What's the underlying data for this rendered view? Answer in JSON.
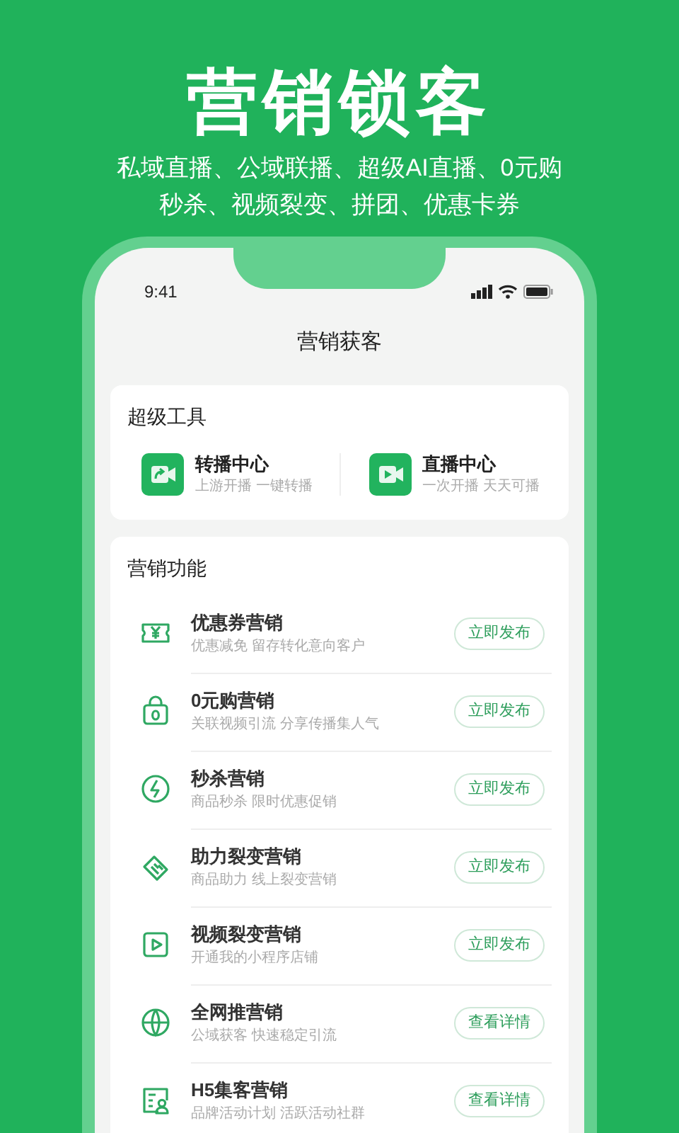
{
  "headline": "营销锁客",
  "subtitle_lines": [
    "私域直播、公域联播、超级AI直播、0元购",
    "秒杀、视频裂变、拼团、优惠卡券"
  ],
  "status_bar": {
    "time": "9:41"
  },
  "screen_title": "营销获客",
  "super_tools": {
    "title": "超级工具",
    "items": [
      {
        "title": "转播中心",
        "subtitle": "上游开播 一键转播"
      },
      {
        "title": "直播中心",
        "subtitle": "一次开播 天天可播"
      }
    ]
  },
  "marketing": {
    "title": "营销功能",
    "items": [
      {
        "title": "优惠券营销",
        "subtitle": "优惠减免 留存转化意向客户",
        "button": "立即发布"
      },
      {
        "title": "0元购营销",
        "subtitle": "关联视频引流 分享传播集人气",
        "button": "立即发布"
      },
      {
        "title": "秒杀营销",
        "subtitle": "商品秒杀 限时优惠促销",
        "button": "立即发布"
      },
      {
        "title": "助力裂变营销",
        "subtitle": "商品助力 线上裂变营销",
        "button": "立即发布"
      },
      {
        "title": "视频裂变营销",
        "subtitle": "开通我的小程序店铺",
        "button": "立即发布"
      },
      {
        "title": "全网推营销",
        "subtitle": "公域获客 快速稳定引流",
        "button": "查看详情"
      },
      {
        "title": "H5集客营销",
        "subtitle": "品牌活动计划 活跃活动社群",
        "button": "查看详情"
      }
    ]
  }
}
